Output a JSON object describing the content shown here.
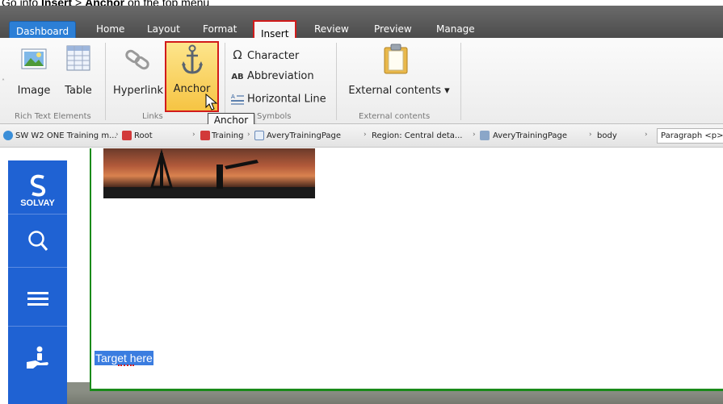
{
  "instruction": {
    "prefix": "Go into ",
    "menu": "Insert",
    "arrow": " > ",
    "item": "Anchor",
    "suffix": " on the top menu"
  },
  "tabs": {
    "dashboard": "Dashboard",
    "home": "Home",
    "layout": "Layout",
    "format": "Format",
    "insert": "Insert",
    "review": "Review",
    "preview": "Preview",
    "manage": "Manage"
  },
  "ribbon": {
    "image_label": "Image",
    "table_label": "Table",
    "hyperlink_label": "Hyperlink",
    "anchor_label": "Anchor",
    "character_label": "Character",
    "abbreviation_label": "Abbreviation",
    "abbreviation_glyph": "AB",
    "hline_label": "Horizontal Line",
    "omega_glyph": "Ω",
    "external_label": "External contents ▾",
    "groups": {
      "rich_text": "Rich Text Elements",
      "links": "Links",
      "symbols": "Symbols",
      "external": "External contents"
    }
  },
  "tooltip": "Anchor",
  "breadcrumb": {
    "items": [
      "SW W2 ONE Training m...",
      "Root",
      "Training",
      "AveryTrainingPage",
      "Region: Central deta...",
      "AveryTrainingPage",
      "body"
    ],
    "current": "Paragraph <p>"
  },
  "sidebar": {
    "brand": "SOLVAY",
    "icons": [
      "solvay-logo-icon",
      "search-icon",
      "menu-icon",
      "hand-user-icon"
    ]
  },
  "content": {
    "target_text": "Target here"
  },
  "colors": {
    "rail": "#1f62d3",
    "dashboard_tab": "#2c7fd6",
    "highlight_border": "#d11b1b",
    "frame_green": "#1a8a1a",
    "selection": "#3b7de0"
  }
}
